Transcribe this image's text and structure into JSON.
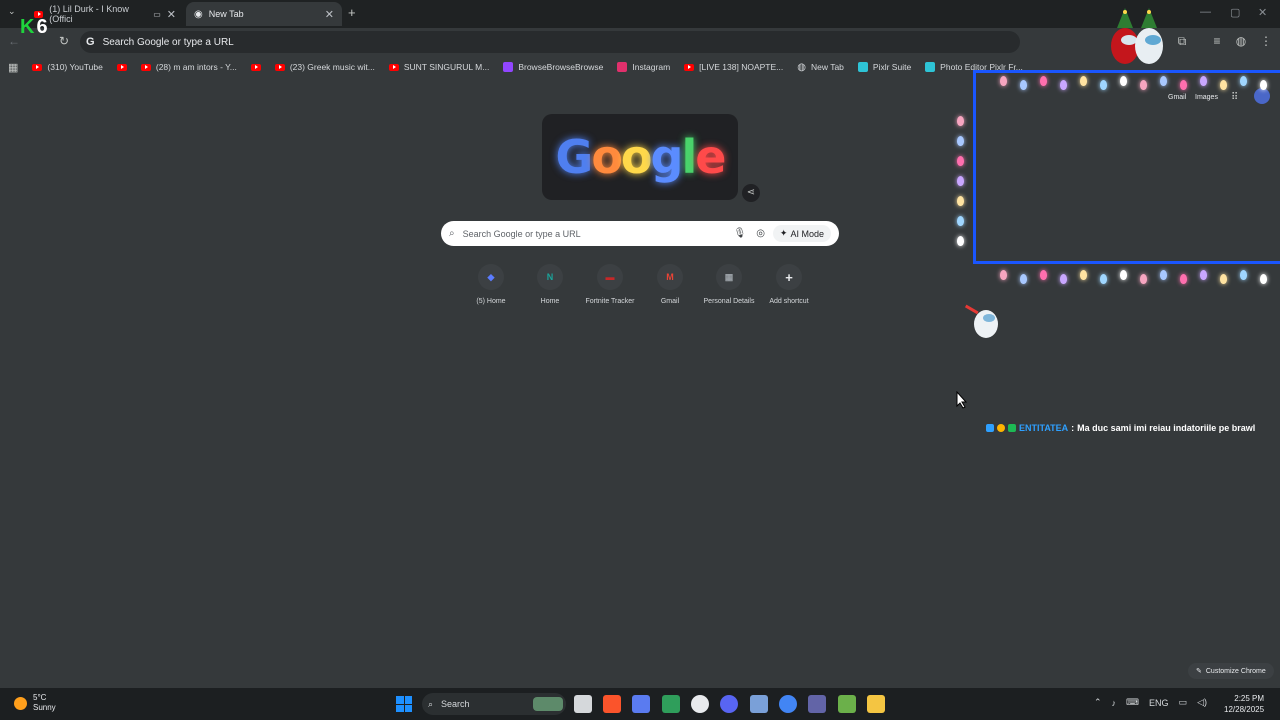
{
  "tabs": [
    {
      "label": "(1) Lil Durk - I Know (Offici",
      "active": false
    },
    {
      "label": "New Tab",
      "active": true
    }
  ],
  "new_tab_symbol": "+",
  "stream_logo": {
    "letter": "K",
    "number": "6"
  },
  "omnibox": {
    "placeholder": "Search Google or type a URL"
  },
  "bookmarks": [
    {
      "label": "(310) YouTube",
      "icon": "youtube-icon"
    },
    {
      "label": "",
      "icon": "youtube-icon"
    },
    {
      "label": "(28) m am intors - Y...",
      "icon": "youtube-icon"
    },
    {
      "label": "",
      "icon": "youtube-icon"
    },
    {
      "label": "(23) Greek music wit...",
      "icon": "youtube-icon"
    },
    {
      "label": "SUNT SINGURUL M...",
      "icon": "youtube-icon"
    },
    {
      "label": "BrowseBrowseBrowse",
      "icon": "twitch-icon"
    },
    {
      "label": "Instagram",
      "icon": "instagram-icon"
    },
    {
      "label": "[LIVE 138] NOAPTE...",
      "icon": "youtube-icon"
    },
    {
      "label": "New Tab",
      "icon": "globe-icon"
    },
    {
      "label": "Pixlr Suite",
      "icon": "pixlr-icon"
    },
    {
      "label": "Photo Editor Pixlr Fr...",
      "icon": "pixlr-icon"
    }
  ],
  "ntp": {
    "doodle_letters": [
      "G",
      "o",
      "o",
      "g",
      "l",
      "e"
    ],
    "search_placeholder": "Search Google or type a URL",
    "ai_mode_label": "AI Mode",
    "gmail_label": "Gmail",
    "images_label": "Images",
    "shortcuts": [
      {
        "label": "(5) Home",
        "glyph": "◆",
        "color": "#5b7cff"
      },
      {
        "label": "Home",
        "glyph": "N",
        "color": "#1aa39a"
      },
      {
        "label": "Fortnite Tracker",
        "glyph": "▬",
        "color": "#c62828"
      },
      {
        "label": "Gmail",
        "glyph": "M",
        "color": "#ea4335"
      },
      {
        "label": "Personal Details",
        "glyph": "▦",
        "color": "#9aa0a6"
      },
      {
        "label": "Add shortcut",
        "glyph": "+",
        "color": "#e8eaed"
      }
    ],
    "customize_label": "Customize Chrome"
  },
  "chat": {
    "username": "ENTITATEA",
    "separator": ":",
    "message": "Ma duc sami imi reiau indatoriile pe brawl"
  },
  "taskbar": {
    "weather_temp": "5°C",
    "weather_desc": "Sunny",
    "search_label": "Search",
    "language": "ENG",
    "time": "2:25 PM",
    "date": "12/28/2025"
  },
  "colors": {
    "background": "#35393b",
    "overlay_frame": "#1a56ff",
    "chat_username": "#2ea0ff",
    "stream_logo": "#1fd33d"
  }
}
